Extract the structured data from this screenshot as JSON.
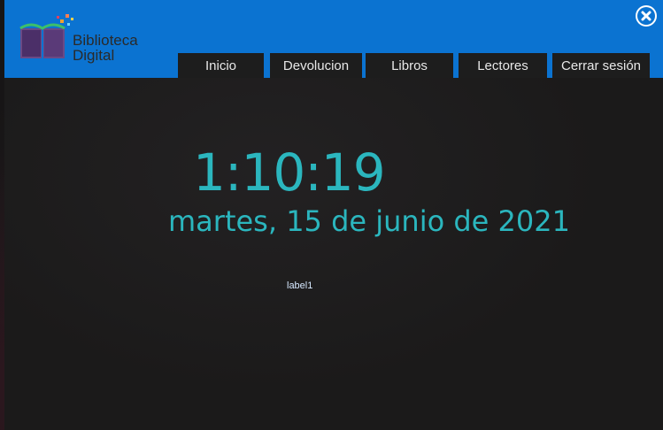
{
  "app": {
    "logo_line1": "Biblioteca",
    "logo_line2": "Digital"
  },
  "nav": {
    "items": [
      {
        "label": "Inicio"
      },
      {
        "label": "Devolucion"
      },
      {
        "label": "Libros"
      },
      {
        "label": "Lectores"
      },
      {
        "label": "Cerrar sesión"
      }
    ]
  },
  "main": {
    "time": "1:10:19",
    "date": "martes, 15 de junio de 2021",
    "label": "label1"
  },
  "icons": {
    "close": "close-icon",
    "logo": "book-logo-icon"
  },
  "colors": {
    "header": "#0b73d1",
    "accent": "#2bb6be",
    "nav_bg": "#1d1d1d"
  }
}
